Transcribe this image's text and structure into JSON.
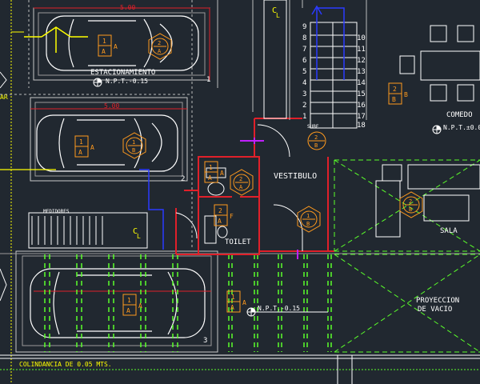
{
  "labels": {
    "estacionamiento": "ESTACIONAMIENTO",
    "npt_015": "N.P.T.-0.15",
    "npt_015_b": "N.P.T.-0.15",
    "npt_comedor": "N.P.T.±0.0",
    "vestibulo": "VESTIBULO",
    "toilet": "TOILET",
    "sala": "SALA",
    "comedor": "COMEDO",
    "medidores": "MEDIDORES",
    "proyeccion_1": "PROYECCION",
    "proyeccion_2": "DE VACIO",
    "colindancia": "COLINDANCIA DE 0.05 MTS.",
    "sube": "SUBE",
    "cl_1": "C",
    "cl_1b": "L",
    "cl_2": "C",
    "cl_2b": "L",
    "ar": "AR",
    "dim_top": "5.00",
    "dim_mid": "5.00",
    "num_1": "1",
    "num_2": "2",
    "num_3": "3"
  },
  "stair_left": [
    "9",
    "8",
    "7",
    "6",
    "5",
    "4",
    "3",
    "2",
    "1"
  ],
  "stair_right": [
    "10",
    "11",
    "12",
    "13",
    "14",
    "15",
    "16",
    "17",
    "18"
  ],
  "tags": [
    {
      "id": "t1",
      "top": "1",
      "bot": "A",
      "side": "A"
    },
    {
      "id": "t2",
      "top": "1",
      "bot": "A",
      "side": "A"
    },
    {
      "id": "t3",
      "top": "1",
      "bot": "A",
      "side": "A"
    },
    {
      "id": "t4",
      "top": "1",
      "bot": "A",
      "side": "A"
    },
    {
      "id": "t5",
      "top": "2",
      "bot": "B",
      "side": "B"
    },
    {
      "id": "t6",
      "top": "2",
      "bot": "A",
      "side": "F"
    },
    {
      "id": "t7",
      "top": "1",
      "bot": "A",
      "side": "A"
    }
  ],
  "hex_tags": [
    {
      "top": "2",
      "bot": "A"
    },
    {
      "top": "1",
      "bot": "B"
    },
    {
      "top": "2",
      "bot": "B"
    },
    {
      "top": "1",
      "bot": "B"
    },
    {
      "top": "2",
      "bot": "B"
    },
    {
      "top": "2",
      "bot": "A"
    }
  ],
  "colors": {
    "background": "#212830",
    "wall": "#e0202a",
    "line": "#ffffff",
    "text": "#ffff00",
    "tag": "#ff9a1e",
    "green": "#5aff2a",
    "blue": "#2a3aff",
    "magenta": "#c020ff"
  }
}
